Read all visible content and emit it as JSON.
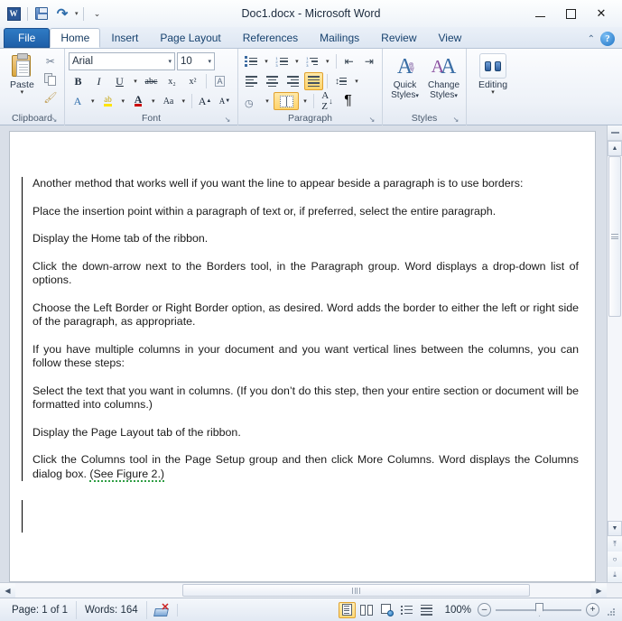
{
  "window": {
    "title": "Doc1.docx  -  Microsoft Word",
    "quick_access": [
      {
        "name": "word-logo",
        "label": "W"
      },
      {
        "name": "save",
        "label": "Save"
      },
      {
        "name": "undo",
        "label": "Undo"
      },
      {
        "name": "customize-qat",
        "label": "Customize Quick Access Toolbar"
      }
    ],
    "controls": {
      "minimize": "–",
      "maximize": "□",
      "close": "✕"
    },
    "collapse_ribbon": "⌃",
    "help": "?"
  },
  "tabs": [
    {
      "label": "File",
      "active": false,
      "kind": "file"
    },
    {
      "label": "Home",
      "active": true,
      "kind": "normal"
    },
    {
      "label": "Insert",
      "active": false,
      "kind": "normal"
    },
    {
      "label": "Page Layout",
      "active": false,
      "kind": "normal"
    },
    {
      "label": "References",
      "active": false,
      "kind": "normal"
    },
    {
      "label": "Mailings",
      "active": false,
      "kind": "normal"
    },
    {
      "label": "Review",
      "active": false,
      "kind": "normal"
    },
    {
      "label": "View",
      "active": false,
      "kind": "normal"
    }
  ],
  "ribbon": {
    "clipboard": {
      "label": "Clipboard",
      "paste": "Paste",
      "cut": "Cut",
      "copy": "Copy",
      "format_painter": "Format Painter",
      "launcher": "↘"
    },
    "font": {
      "label": "Font",
      "font_name": "Arial",
      "font_size": "10",
      "bold": "B",
      "italic": "I",
      "underline": "U",
      "strikethrough": "abc",
      "subscript": "x₂",
      "superscript": "x²",
      "clear_formatting": "Clear Formatting",
      "text_effects": "A",
      "highlight": "ab",
      "font_color": "A",
      "change_case": "Aa",
      "grow_font": "A",
      "shrink_font": "A",
      "launcher": "↘"
    },
    "paragraph": {
      "label": "Paragraph",
      "bullets": "Bullets",
      "numbering": "Numbering",
      "multilevel": "Multilevel List",
      "decrease_indent": "Decrease Indent",
      "increase_indent": "Increase Indent",
      "align_left": "Align Text Left",
      "center": "Center",
      "align_right": "Align Text Right",
      "justify": "Justify",
      "line_spacing": "Line and Paragraph Spacing",
      "shading": "Shading",
      "borders": "Borders",
      "sort": "Sort",
      "show_marks": "¶",
      "launcher": "↘"
    },
    "styles": {
      "label": "Styles",
      "quick_styles": "Quick Styles",
      "change_styles": "Change Styles",
      "caret": "▾",
      "launcher": "↘"
    },
    "editing": {
      "label": "Editing",
      "button": "Editing",
      "caret": "▾"
    }
  },
  "document": {
    "paragraphs": [
      {
        "text": "Another method that works well if you want the line to appear beside a paragraph is to use borders:",
        "justified": false
      },
      {
        "text": "Place the insertion point within a paragraph of text or, if preferred, select the entire paragraph.",
        "justified": false
      },
      {
        "text": "Display the Home tab of the ribbon.",
        "justified": false
      },
      {
        "text": "Click the down-arrow next to the Borders tool, in the Paragraph group. Word displays a drop-down list of options.",
        "justified": false
      },
      {
        "text": "Choose the Left Border or Right Border option, as desired. Word adds the border to either the left or right side of the paragraph, as appropriate.",
        "justified": false
      },
      {
        "text": "If you have multiple columns in your document and you want vertical lines between the columns, you can follow these steps:",
        "justified": false
      },
      {
        "text": "Select the text that you want in columns. (If you don’t do this step, then your entire section or document will be formatted into columns.)",
        "justified": false
      },
      {
        "text": "Display the Page Layout tab of the ribbon.",
        "justified": false
      }
    ],
    "last_paragraph": {
      "text_before": "Click the Columns tool in the Page Setup group and then click More Columns. Word displays the Columns dialog box. ",
      "grammar_text": "(See Figure 2.)"
    }
  },
  "scrollbars": {
    "split": "Split",
    "up": "▲",
    "down": "▼",
    "left": "◀",
    "right": "▶",
    "previous_page": "⤒",
    "select_browse_object": "○",
    "next_page": "⤓"
  },
  "statusbar": {
    "page": "Page: 1 of 1",
    "words": "Words: 164",
    "proofing": "Proofing errors",
    "views": [
      {
        "name": "print-layout",
        "label": "Print Layout",
        "active": true
      },
      {
        "name": "full-screen-reading",
        "label": "Full Screen Reading",
        "active": false
      },
      {
        "name": "web-layout",
        "label": "Web Layout",
        "active": false
      },
      {
        "name": "outline",
        "label": "Outline",
        "active": false
      },
      {
        "name": "draft",
        "label": "Draft",
        "active": false
      }
    ],
    "zoom": "100%",
    "zoom_out": "–",
    "zoom_in": "+"
  }
}
